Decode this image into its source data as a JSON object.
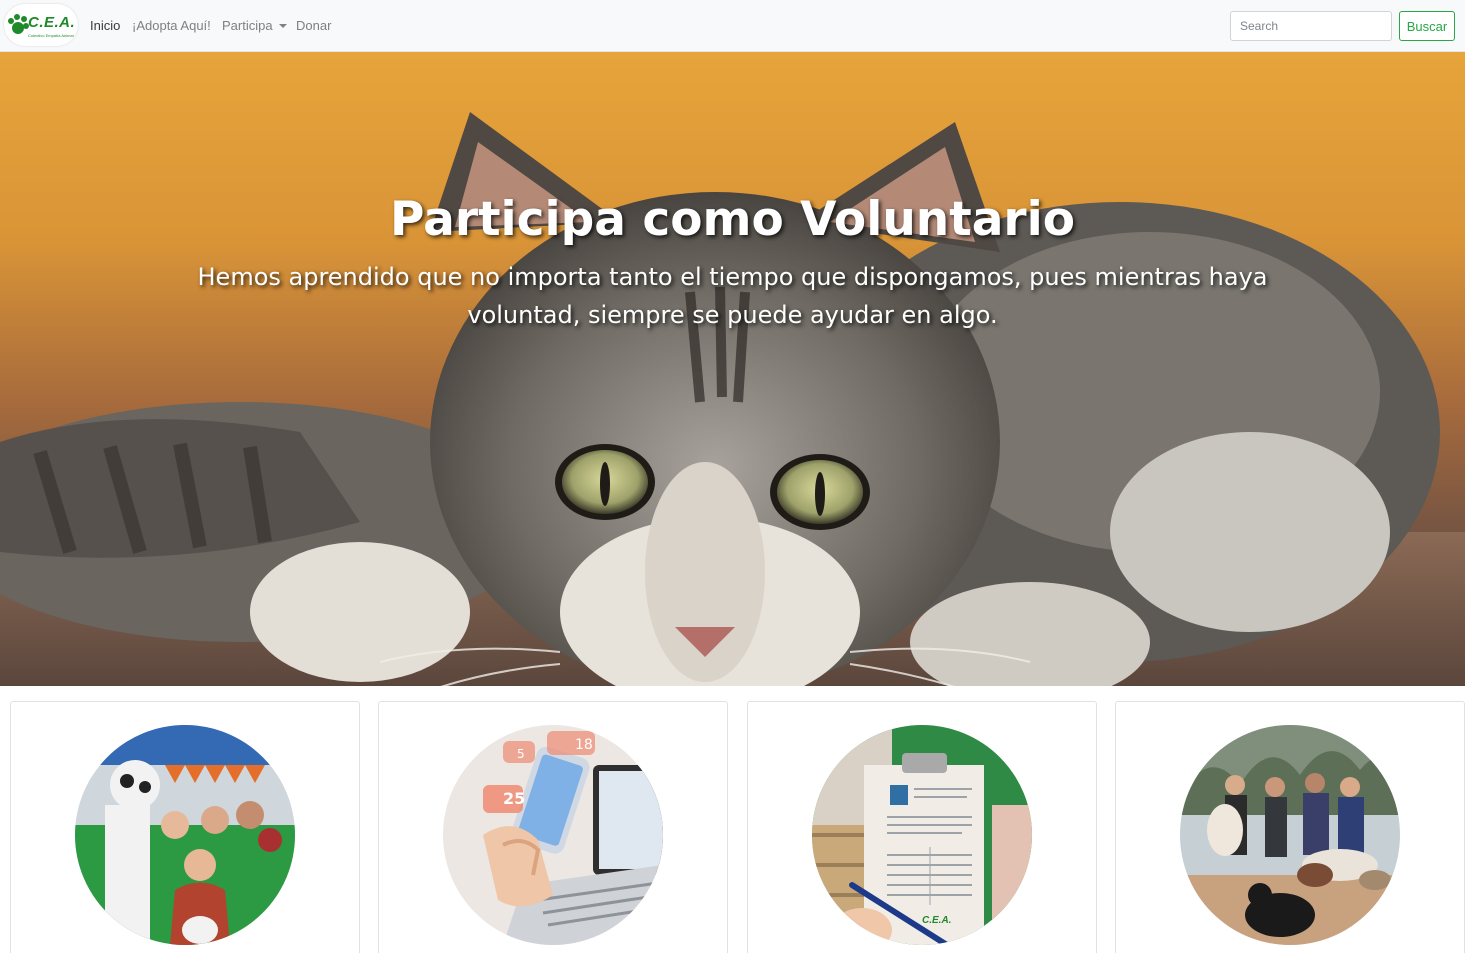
{
  "navbar": {
    "brand": {
      "text": "C.E.A.",
      "subtitle": "Colectivo Empatía Animal"
    },
    "links": [
      {
        "label": "Inicio"
      },
      {
        "label": "¡Adopta Aquí!"
      },
      {
        "label": "Participa"
      },
      {
        "label": "Donar"
      }
    ],
    "search": {
      "placeholder": "Search",
      "button_label": "Buscar"
    }
  },
  "hero": {
    "title": "Participa como Voluntario",
    "subtitle": "Hemos aprendido que no importa tanto el tiempo que dispongamos, pues mientras haya voluntad, siempre se puede ayudar en algo."
  },
  "cards": [
    {
      "image": "volunteers-group-photo"
    },
    {
      "image": "social-media-phone-photo",
      "badges": [
        "5",
        "18",
        "25"
      ]
    },
    {
      "image": "clipboard-form-photo"
    },
    {
      "image": "dog-walk-photo"
    }
  ],
  "colors": {
    "brand_green": "#1f8a2a",
    "search_button": "#28a745",
    "navbar_bg": "#f8f9fa"
  }
}
